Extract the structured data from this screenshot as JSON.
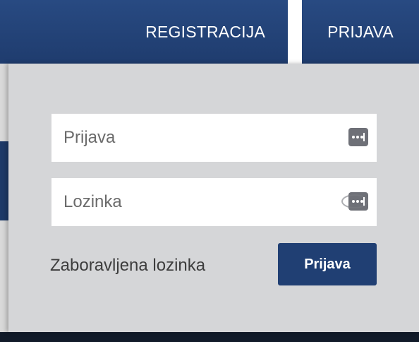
{
  "nav": {
    "register_label": "REGISTRACIJA",
    "login_label": "PRIJAVA"
  },
  "form": {
    "username_placeholder": "Prijava",
    "password_placeholder": "Lozinka",
    "forgot_label": "Zaboravljena lozinka",
    "submit_label": "Prijava"
  },
  "icons": {
    "username_field": "password-manager-key-icon",
    "password_field": "password-manager-key-icon"
  },
  "colors": {
    "nav_blue": "#26467e",
    "button_blue": "#203f73",
    "panel_gray": "#d5d6d8"
  }
}
